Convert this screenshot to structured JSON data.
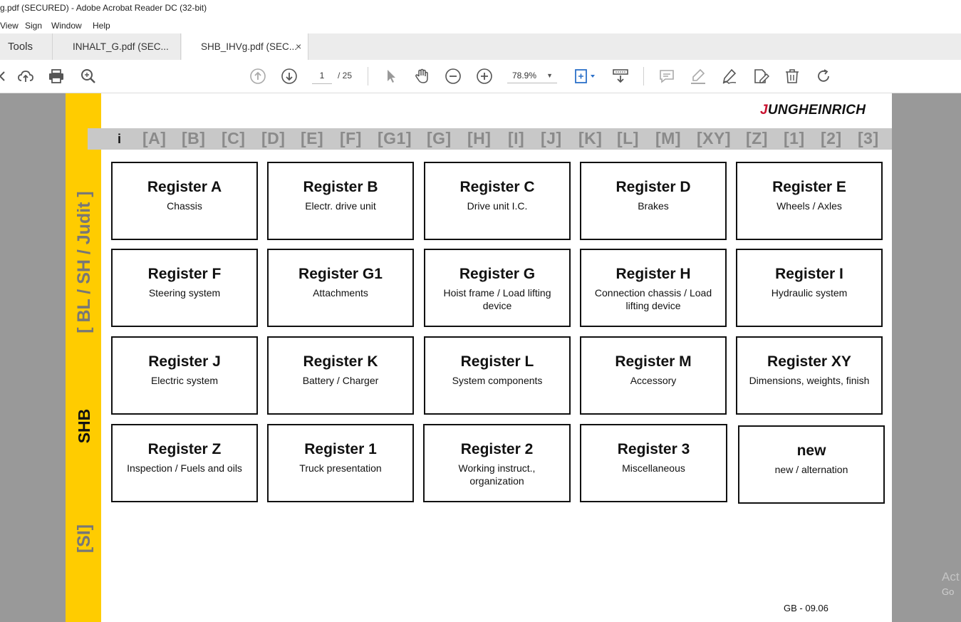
{
  "window": {
    "title": "g.pdf (SECURED) - Adobe Acrobat Reader DC (32-bit)"
  },
  "menu": {
    "items": [
      "View",
      "Sign",
      "Window",
      "Help"
    ]
  },
  "tabs": {
    "tools": "Tools",
    "tab1": "INHALT_G.pdf (SEC...",
    "tab2": "SHB_IHVg.pdf (SEC...",
    "close": "×"
  },
  "toolbar": {
    "page_current": "1",
    "page_total": "/ 25",
    "zoom": "78.9%",
    "icons": [
      "upload-cloud-icon",
      "print-icon",
      "search-zoom-icon",
      "previous-page-icon",
      "next-page-icon",
      "select-cursor-icon",
      "hand-tool-icon",
      "zoom-out-icon",
      "zoom-in-icon",
      "fit-page-icon",
      "scroll-mode-icon",
      "comment-icon",
      "highlight-icon",
      "sign-icon",
      "fill-sign-icon",
      "delete-icon",
      "rotate-icon"
    ]
  },
  "document": {
    "logo": "JUNGHEINRICH",
    "sidebar": {
      "bl": "[ BL / SH / Judit ]",
      "shb": "SHB",
      "si": "[SI]"
    },
    "index": [
      "i",
      "[A]",
      "[B]",
      "[C]",
      "[D]",
      "[E]",
      "[F]",
      "[G1]",
      "[G]",
      "[H]",
      "[I]",
      "[J]",
      "[K]",
      "[L]",
      "[M]",
      "[XY]",
      "[Z]",
      "[1]",
      "[2]",
      "[3]"
    ],
    "registers": [
      {
        "title": "Register A",
        "sub": "Chassis"
      },
      {
        "title": "Register B",
        "sub": "Electr. drive unit"
      },
      {
        "title": "Register C",
        "sub": "Drive unit I.C."
      },
      {
        "title": "Register D",
        "sub": "Brakes"
      },
      {
        "title": "Register E",
        "sub": "Wheels / Axles"
      },
      {
        "title": "Register F",
        "sub": "Steering system"
      },
      {
        "title": "Register G1",
        "sub": "Attachments"
      },
      {
        "title": "Register G",
        "sub": "Hoist frame / Load lifting device"
      },
      {
        "title": "Register H",
        "sub": "Connection chassis / Load lifting device"
      },
      {
        "title": "Register I",
        "sub": "Hydraulic system"
      },
      {
        "title": "Register J",
        "sub": "Electric system"
      },
      {
        "title": "Register K",
        "sub": "Battery / Charger"
      },
      {
        "title": "Register L",
        "sub": "System components"
      },
      {
        "title": "Register M",
        "sub": "Accessory"
      },
      {
        "title": "Register XY",
        "sub": "Dimensions, weights, finish"
      },
      {
        "title": "Register Z",
        "sub": "Inspection / Fuels and oils"
      },
      {
        "title": "Register 1",
        "sub": "Truck presentation"
      },
      {
        "title": "Register 2",
        "sub": "Working instruct., organization"
      },
      {
        "title": "Register 3",
        "sub": "Miscellaneous"
      },
      {
        "title": "new",
        "sub": "new / alternation"
      }
    ],
    "footer": "GB - 09.06"
  },
  "watermark": {
    "line1": "Act",
    "line2": "Go"
  }
}
